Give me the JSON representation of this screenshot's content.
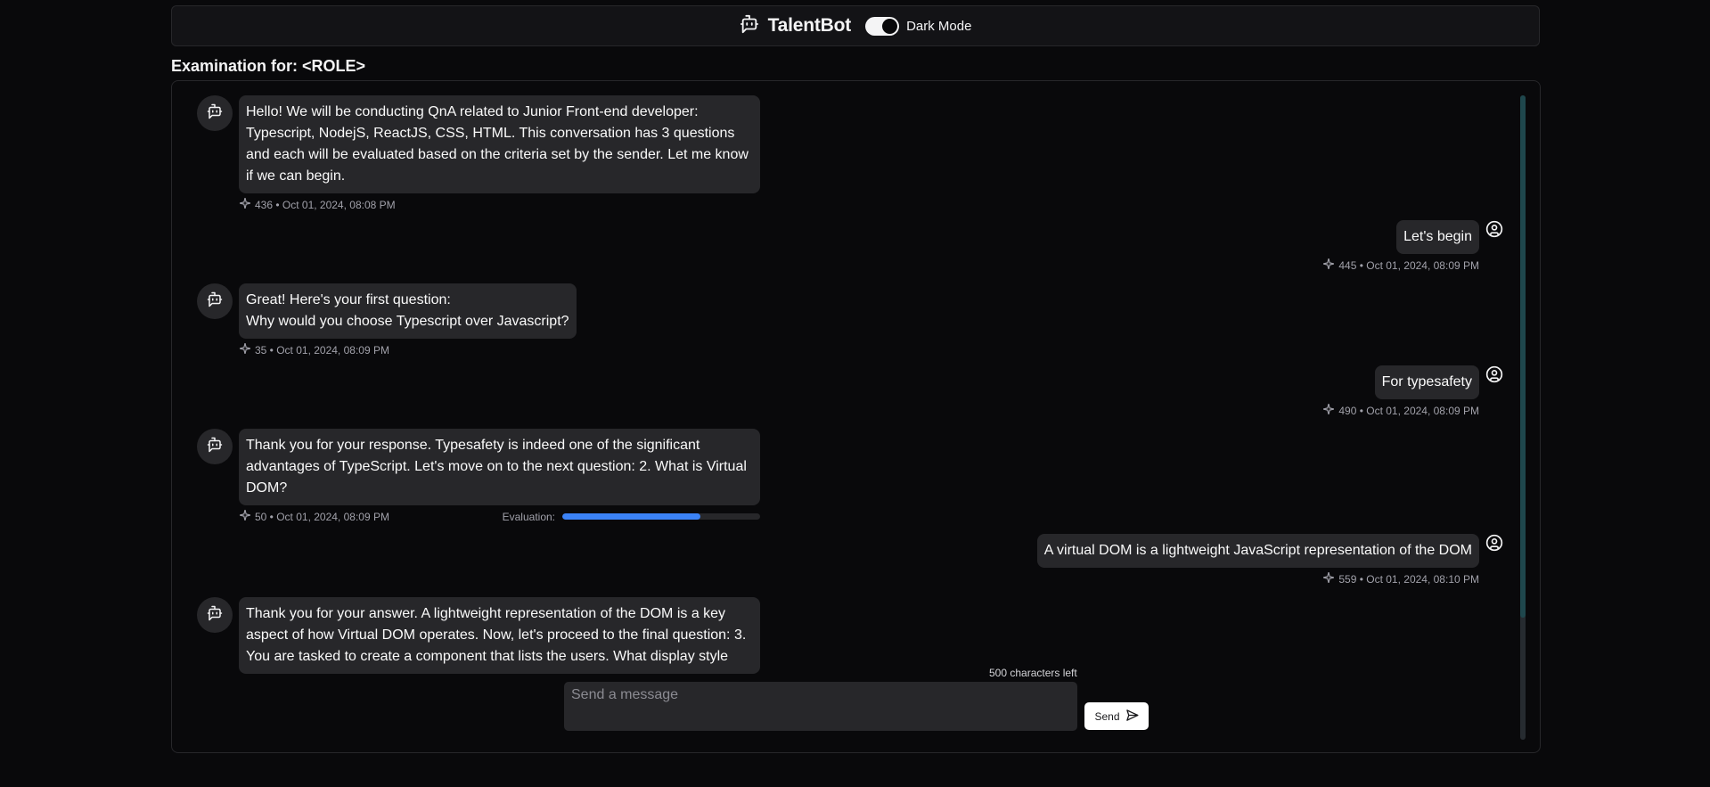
{
  "header": {
    "brand_icon": "bot-message-icon",
    "title": "TalentBot",
    "dark_mode_label": "Dark Mode",
    "dark_mode_on": true
  },
  "exam_title": "Examination for: <ROLE>",
  "messages": [
    {
      "sender": "bot",
      "text": "Hello! We will be conducting QnA related to Junior Front-end developer: Typescript, NodejS, ReactJS, CSS, HTML. This conversation has 3 questions and each will be evaluated based on the criteria set by the sender. Let me know if we can begin.",
      "meta": "436 • Oct 01, 2024, 08:08 PM"
    },
    {
      "sender": "user",
      "text": "Let's begin",
      "meta": "445 • Oct 01, 2024, 08:09 PM"
    },
    {
      "sender": "bot",
      "text": "Great! Here's your first question:\nWhy would you choose Typescript over Javascript?",
      "meta": "35 • Oct 01, 2024, 08:09 PM"
    },
    {
      "sender": "user",
      "text": "For typesafety",
      "meta": "490 • Oct 01, 2024, 08:09 PM"
    },
    {
      "sender": "bot",
      "text": "Thank you for your response. Typesafety is indeed one of the significant advantages of TypeScript. Let's move on to the next question: 2. What is Virtual DOM?",
      "meta": "50 • Oct 01, 2024, 08:09 PM",
      "evaluation_label": "Evaluation:",
      "evaluation_percent": 70
    },
    {
      "sender": "user",
      "text": "A virtual DOM is a lightweight JavaScript representation of the DOM",
      "meta": "559 • Oct 01, 2024, 08:10 PM"
    },
    {
      "sender": "bot",
      "text": "Thank you for your answer. A lightweight representation of the DOM is a key aspect of how Virtual DOM operates. Now, let's proceed to the final question: 3. You are tasked to create a component that lists the users. What display style",
      "meta": ""
    }
  ],
  "composer": {
    "chars_left": "500 characters left",
    "placeholder": "Send a message",
    "value": "",
    "send_label": "Send"
  },
  "colors": {
    "background": "#09090b",
    "bubble": "#27272a",
    "evaluation_fill": "#3b82f6",
    "scroll_thumb": "#1f474d"
  }
}
